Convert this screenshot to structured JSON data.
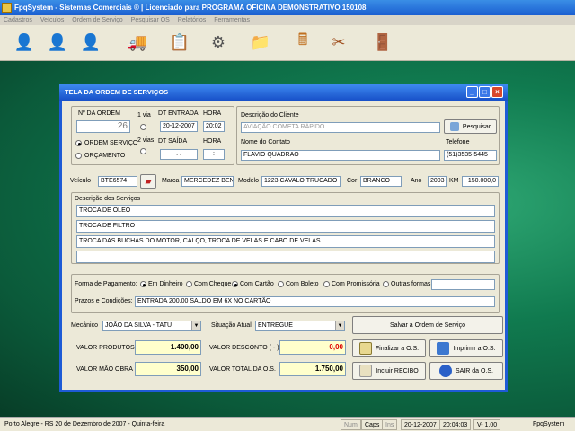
{
  "app": {
    "title": "FpqSystem - Sistemas Comerciais ®  | Licenciado para  PROGRAMA OFICINA DEMONSTRATIVO 150108"
  },
  "menu": [
    "Cadastros",
    "Veículos",
    "Ordem de Serviço",
    "Pesquisar OS",
    "Relatórios",
    "Ferramentas"
  ],
  "toolbar": {
    "icons": [
      "person-blue-icon",
      "person-red-icon",
      "person-green-icon",
      "truck-icon",
      "clipboard-icon",
      "gears-icon",
      "folder-icon",
      "calculator-icon",
      "tools-icon",
      "exit-icon"
    ],
    "glyphs": [
      "👤",
      "👤",
      "👤",
      "🚚",
      "📋",
      "⚙",
      "📁",
      "🖩",
      "✂",
      "🚪"
    ]
  },
  "window": {
    "title": "TELA DA ORDEM DE SERVIÇOS"
  },
  "order": {
    "number_label": "Nº DA ORDEM",
    "number": "26",
    "via1_label": "1 via",
    "via2_label": "2 vias",
    "dt_entrada_label": "DT ENTRADA",
    "dt_entrada": "20-12-2007",
    "hora_label": "HORA",
    "hora_entrada": "20:02",
    "dt_saida_label": "DT SAÍDA",
    "dt_saida": "  .  .",
    "hora_saida_label": "HORA",
    "hora_saida": " :",
    "tipo_os": "ORDEM SERVIÇO",
    "tipo_orc": "ORÇAMENTO"
  },
  "client": {
    "desc_label": "Descrição do Cliente",
    "desc": "AVIAÇÃO COMETA RÁPIDO",
    "search_btn": "Pesquisar",
    "contact_label": "Nome do Contato",
    "contact": "FLAVIO QUADRAO",
    "phone_label": "Telefone",
    "phone": "(51)3535-5445"
  },
  "vehicle": {
    "label": "Veículo",
    "plate": "BTE6574",
    "marca_label": "Marca",
    "marca": "MERCEDEZ BEN",
    "modelo_label": "Modelo",
    "modelo": "1223 CAVALO TRUCADO",
    "cor_label": "Cor",
    "cor": "BRANCO",
    "ano_label": "Ano",
    "ano": "2003",
    "km_label": "KM",
    "km": "150.000,0"
  },
  "services": {
    "label": "Descrição dos Serviços",
    "lines": [
      "TROCA DE OLEO",
      "TROCA DE FILTRO",
      "TROCA DAS BUCHAS DO MOTOR, CALÇO, TROCA DE VELAS E CABO DE VELAS",
      ""
    ]
  },
  "payment": {
    "label": "Forma de Pagamento:",
    "options": [
      "Em Dinheiro",
      "Com Cheque",
      "Com Cartão",
      "Com Boleto",
      "Com Promissória",
      "Outras formas"
    ],
    "prazos_label": "Prazos e  Condições:",
    "prazos": "ENTRADA 200,00 SALDO EM 6X NO CARTÃO"
  },
  "bottom": {
    "mecanico_label": "Mecânico",
    "mecanico": "JOÃO DA SILVA - TATU",
    "situacao_label": "Situação Atual",
    "situacao": "ENTREGUE",
    "save_btn": "Salvar a Ordem de Serviço",
    "vp_label": "VALOR PRODUTOS",
    "vp": "1.400,00",
    "vd_label": "VALOR DESCONTO ( - )",
    "vd": "0,00",
    "vm_label": "VALOR MÃO OBRA",
    "vm": "350,00",
    "vt_label": "VALOR TOTAL DA O.S.",
    "vt": "1.750,00",
    "finalizar_btn": "Finalizar a O.S.",
    "imprimir_btn": "Imprimir a O.S.",
    "recibo_btn": "Incluir RECIBO",
    "sair_btn": "SAIR da O.S."
  },
  "status": {
    "location": "Porto Alegre - RS 20 de Dezembro de 2007 - Quinta-feira",
    "num": "Num",
    "caps": "Caps",
    "ins": "Ins",
    "date": "20-12-2007",
    "time": "20:04:03",
    "version": "V-  1.00",
    "app": "FpqSystem"
  },
  "colors": {
    "titlebar": "#1b5fd1",
    "window_bg": "#ece9d8",
    "yellow_field": "#ffffcc",
    "desktop": "#107a4f"
  }
}
